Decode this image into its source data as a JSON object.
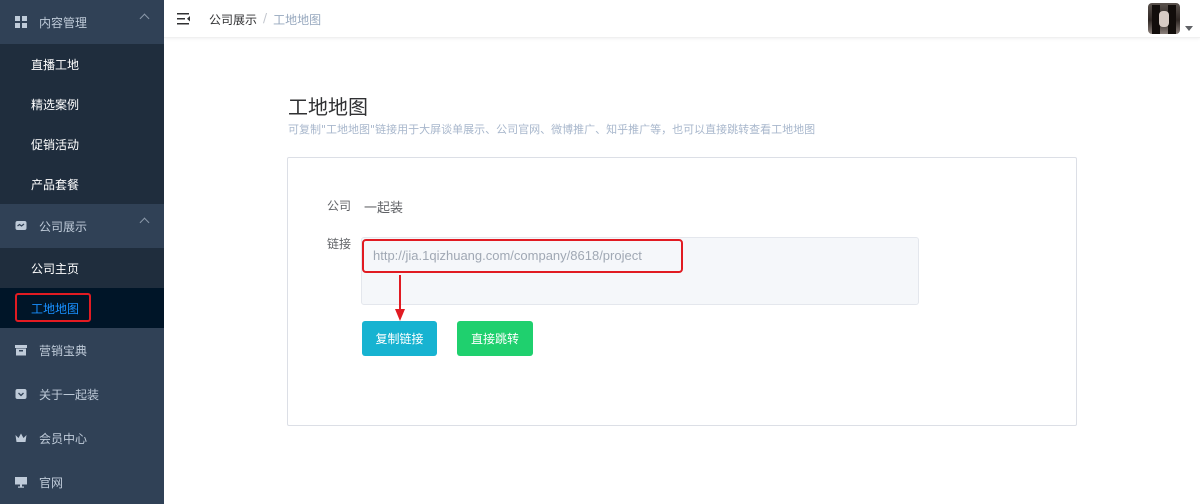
{
  "sidebar": {
    "group1": {
      "label": "内容管理",
      "icon": "grid-icon",
      "items": [
        "直播工地",
        "精选案例",
        "促销活动",
        "产品套餐"
      ]
    },
    "group2": {
      "label": "公司展示",
      "icon": "chat-icon",
      "items": [
        "公司主页",
        "工地地图"
      ],
      "active": "工地地图"
    },
    "items": [
      {
        "label": "营销宝典",
        "icon": "archive-icon"
      },
      {
        "label": "关于一起装",
        "icon": "pocket-icon"
      },
      {
        "label": "会员中心",
        "icon": "crown-icon"
      },
      {
        "label": "官网",
        "icon": "monitor-icon"
      }
    ]
  },
  "topbar": {
    "breadcrumb": [
      "公司展示",
      "工地地图"
    ],
    "separator": "/"
  },
  "main": {
    "title": "工地地图",
    "description": "可复制\"工地地图\"链接用于大屏谈单展示、公司官网、微博推广、知乎推广等，也可以直接跳转查看工地地图",
    "company_label": "公司",
    "company_value": "一起装",
    "link_label": "链接",
    "link_value": "http://jia.1qizhuang.com/company/8618/project",
    "copy_button": "复制链接",
    "jump_button": "直接跳转"
  },
  "colors": {
    "sidebar_bg": "#304156",
    "submenu_bg": "#1f2d3d",
    "active_text": "#1890ff",
    "copy_button": "#17b3d1",
    "jump_button": "#1fd06e",
    "highlight": "#e11b22"
  }
}
